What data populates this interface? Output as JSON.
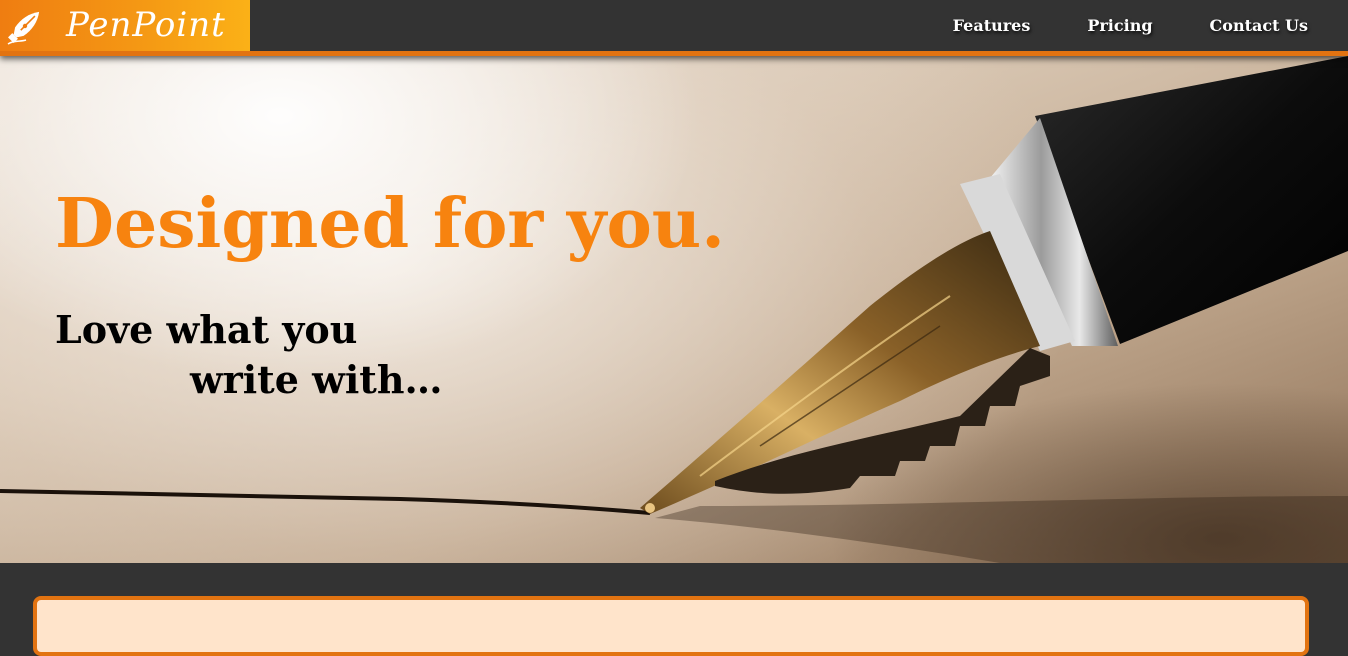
{
  "brand": {
    "name": "PenPoint",
    "icon": "fountain-pen-nib-icon",
    "gradient_start": "#ef7d11",
    "gradient_end": "#fbb117"
  },
  "nav": {
    "items": [
      {
        "label": "Features"
      },
      {
        "label": "Pricing"
      },
      {
        "label": "Contact Us"
      }
    ]
  },
  "hero": {
    "title": "Designed for you.",
    "subtitle_line1": "Love what you",
    "subtitle_line2": "write with…",
    "image": "fountain-pen-writing-on-paper"
  },
  "colors": {
    "accent": "#f7830f",
    "border": "#e27311",
    "navbar_bg": "#333333",
    "panel_bg": "#ffe4cb"
  }
}
